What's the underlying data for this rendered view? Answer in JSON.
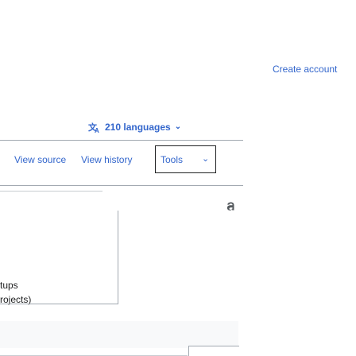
{
  "header": {
    "create_account_label": "Create account"
  },
  "language_switcher": {
    "label": "210 languages",
    "icon": "translate-icon",
    "chevron": "chevron-down-icon"
  },
  "tabs": {
    "view_source": "View source",
    "view_history": "View history",
    "tools": "Tools",
    "tools_chevron": "chevron-down-icon"
  },
  "sidebar": {
    "line1": "tups",
    "line2": "rojects)"
  },
  "icons": {
    "font_size": "font-size-icon"
  },
  "colors": {
    "link": "#3366cc",
    "text": "#202122",
    "border": "#a2a9b1",
    "panel": "#f8f9fa"
  }
}
